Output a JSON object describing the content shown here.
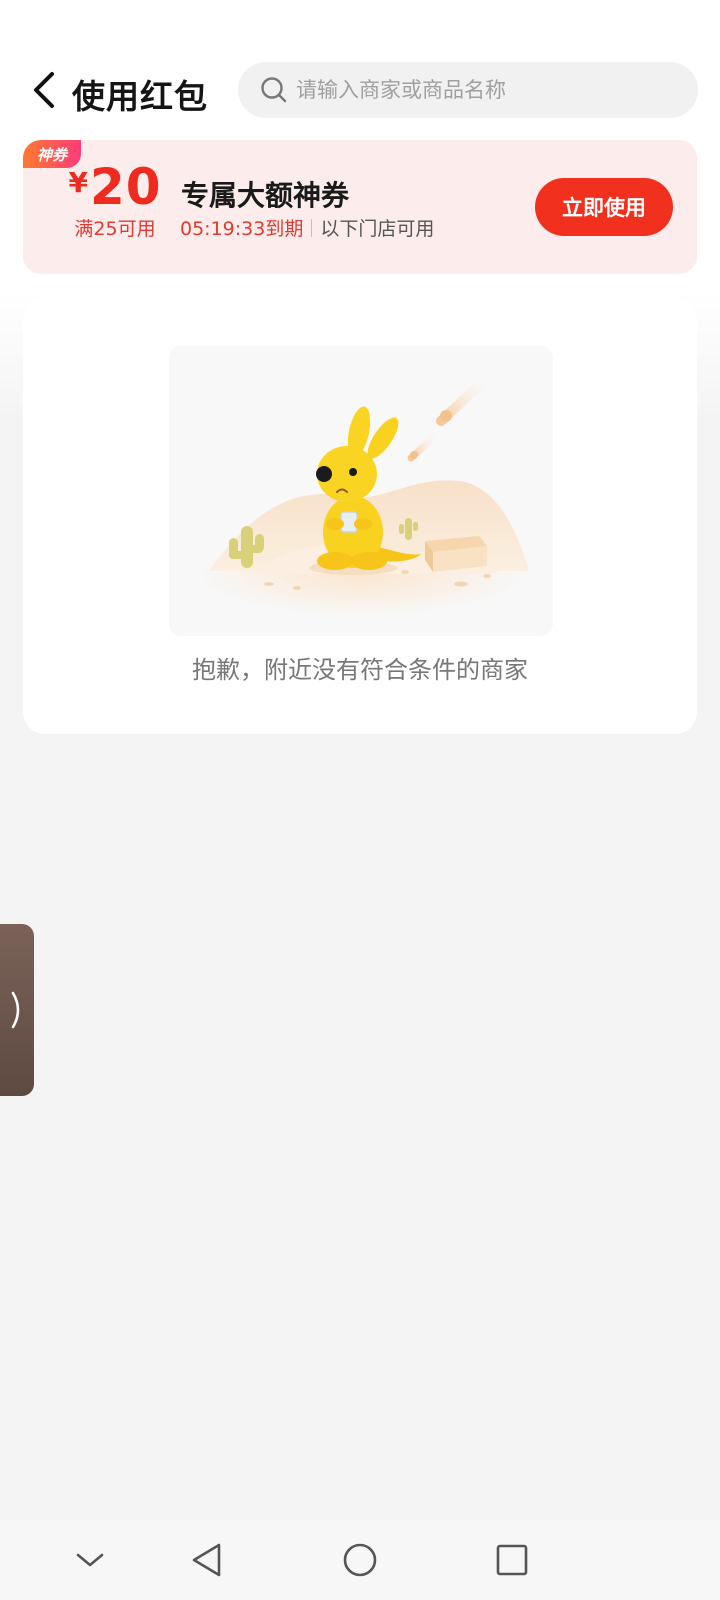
{
  "header": {
    "title": "使用红包",
    "search_placeholder": "请输入商家或商品名称"
  },
  "coupon": {
    "tag": "神券",
    "currency": "¥",
    "amount": "20",
    "condition": "满25可用",
    "name": "专属大额神券",
    "expire": "05:19:33到期",
    "scope": "以下门店可用",
    "use_label": "立即使用",
    "accent_color": "#f2301e"
  },
  "empty": {
    "message": "抱歉，附近没有符合条件的商家",
    "illustration": "yellow-kangaroo-mascot-desert"
  },
  "side_handle": {
    "icon": "chevron-right-icon"
  },
  "bottom_nav": {
    "items": [
      "chevron-down-icon",
      "back-triangle-icon",
      "home-circle-icon",
      "recents-square-icon"
    ]
  }
}
